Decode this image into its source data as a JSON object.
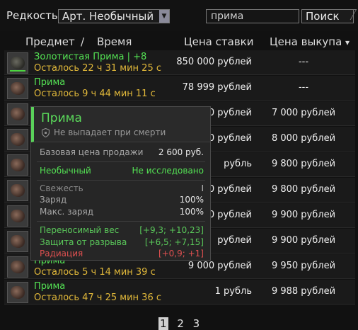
{
  "filters": {
    "rarity_label": "Редкость",
    "rarity_value": "Арт. Необычный",
    "search_value": "прима",
    "search_button": "Поиск"
  },
  "table": {
    "headers": {
      "item": "Предмет",
      "slash": "/",
      "time": "Время",
      "bid": "Цена ставки",
      "buyout": "Цена выкупа",
      "sort_icon": "▾"
    },
    "rows": [
      {
        "name": "Золотистая Прима | +8",
        "time": "Осталось 22 ч 31 мин 25 с",
        "bid": "850 000 рублей",
        "buyout": "---"
      },
      {
        "name": "Прима",
        "time": "Осталось 9 ч 44 мин 11 с",
        "bid": "78 999 рублей",
        "buyout": "---"
      },
      {
        "name": "",
        "time": "",
        "bid": "0 рублей",
        "buyout": "7 000 рублей"
      },
      {
        "name": "",
        "time": "",
        "bid": "0 рублей",
        "buyout": "8 000 рублей"
      },
      {
        "name": "",
        "time": "",
        "bid": "рубль",
        "buyout": "9 800 рублей"
      },
      {
        "name": "",
        "time": "",
        "bid": "0 рублей",
        "buyout": "9 800 рублей"
      },
      {
        "name": "",
        "time": "",
        "bid": "0 рублей",
        "buyout": "9 900 рублей"
      },
      {
        "name": "",
        "time": "",
        "bid": "рублей",
        "buyout": "9 900 рублей"
      },
      {
        "name": "Прима",
        "time": "Осталось 5 ч 14 мин 39 с",
        "bid": "9 000 рублей",
        "buyout": "9 950 рублей"
      },
      {
        "name": "Прима",
        "time": "Осталось 47 ч 25 мин 36 с",
        "bid": "1 рубль",
        "buyout": "9 988 рублей"
      }
    ]
  },
  "pagination": {
    "pages": [
      "1",
      "2",
      "3"
    ],
    "current": "1"
  },
  "tooltip": {
    "title": "Прима",
    "no_drop": "Не выпадает при смерти",
    "base_price_label": "Базовая цена продажи",
    "base_price_value": "2 600 руб.",
    "rarity_label": "Необычный",
    "research_status": "Не исследовано",
    "freshness_label": "Свежесть",
    "freshness_value": "I",
    "charge_label": "Заряд",
    "charge_value": "100%",
    "max_charge_label": "Макс. заряд",
    "max_charge_value": "100%",
    "carry_weight_label": "Переносимый вес",
    "carry_weight_value": "[+9,3; +10,23]",
    "tear_protection_label": "Защита от разрыва",
    "tear_protection_value": "[+6,5; +7,15]",
    "radiation_label": "Радиация",
    "radiation_value": "[+0,9; +1]"
  },
  "colors": {
    "green": "#54e354",
    "gold": "#e2b93a",
    "red": "#e05050",
    "accent_border": "#5ad15a"
  },
  "icons": [
    "dropdown-arrow-icon",
    "sort-desc-icon",
    "shield-icon",
    "artifact-icon"
  ]
}
